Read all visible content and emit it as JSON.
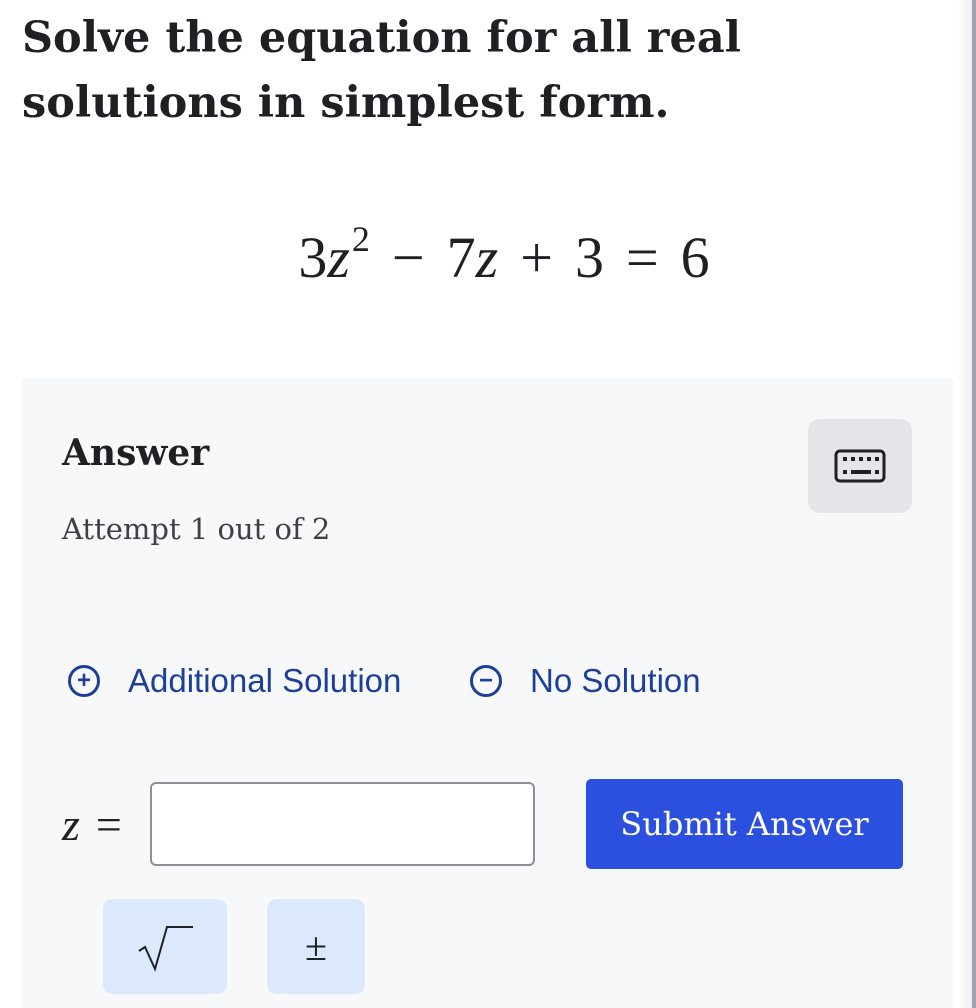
{
  "question": {
    "text": "Solve the equation for all real solutions in simplest form."
  },
  "equation": {
    "coef": "3",
    "var": "z",
    "exponent": "2",
    "minus": "−",
    "term2_coef": "7",
    "term2_var": "z",
    "plus": "+",
    "constant": "3",
    "equals": "=",
    "rhs": "6"
  },
  "answer": {
    "title": "Answer",
    "attempt": "Attempt 1 out of 2",
    "keyboard_icon": "keyboard-icon"
  },
  "options": {
    "additional_solution": "Additional Solution",
    "additional_icon": "+",
    "no_solution": "No Solution",
    "no_solution_icon": "−"
  },
  "input": {
    "variable": "z",
    "equals": "=",
    "value": ""
  },
  "submit": {
    "label": "Submit Answer"
  },
  "tools": {
    "sqrt_icon": "sqrt-icon",
    "plus_minus": "±"
  },
  "colors": {
    "accent": "#2b50e0",
    "link": "#1d3f99",
    "panel": "#f7f8fa",
    "tool_button": "#dce8fb"
  }
}
